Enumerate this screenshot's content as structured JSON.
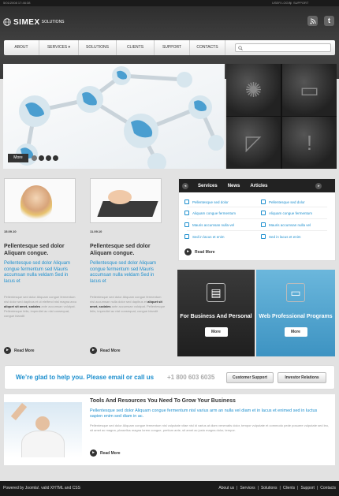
{
  "topbar": {
    "date": "5/01/2008 17:46:38",
    "links": [
      "USER LOGIN",
      "SUPPORT"
    ]
  },
  "brand": {
    "name": "SIMEX",
    "suffix": "SOLUTIONS"
  },
  "nav": {
    "items": [
      "ABOUT",
      "SERVICES",
      "SOLUTIONS",
      "CLIENTS",
      "SUPPORT",
      "CONTACTS"
    ],
    "dropdown_index": 1
  },
  "slider": {
    "caption": "More"
  },
  "cards": [
    {
      "date": "15.09.10",
      "title": "Pellentesque sed dolor Aliquam congue.",
      "blue": "Pellentesque sed dolor Aliquam congue fermentum sed Mauris accumsan nulla veldam Sed in lacus et",
      "body_pre": "Pellentesque sed dolor Aliquam congue fermentum nisl dolor sed dapibus et ut eleifend nisl magna arcu",
      "body_bold": "aliquet sit amet, sodales",
      "body_post": "ante accumsan volutpat. Pellentesque felis, imperdiet ac nisl consequat, congue blandit",
      "readmore": "Read More"
    },
    {
      "date": "11.09.10",
      "title": "Pellentesque sed dolor Aliquam congue.",
      "blue": "Pellentesque sed dolor Aliquam congue fermentum sed Mauris accumsan nulla veldam Sed in lacus et",
      "body_pre": "Pellentesque sed dolor Aliquam congue fermentum nisl accumsan nulla dolor sed dapibus et",
      "body_bold": "aliquet sit amet, sodales",
      "body_post": "ante accumsan volutpat. Pellentesque felis, imperdiet ac nisl consequat, congue blandit",
      "readmore": "Read More"
    }
  ],
  "tabs": {
    "labels": [
      "Services",
      "News",
      "Articles"
    ],
    "links_left": [
      "Pellentesque sed dolor",
      "Aliquam congue fermentum",
      "Mauris accumsan nulla vel",
      "Sed in lacus et enim"
    ],
    "links_right": [
      "Pellentesque sed dolor",
      "Aliquam congue fermentum",
      "Mauris accumsan nulla vel",
      "Sed in lacus et enim"
    ],
    "readmore": "Read More"
  },
  "promos": [
    {
      "title": "For Business And Personal",
      "button": "More"
    },
    {
      "title": "Web Professional Programs",
      "button": "More"
    }
  ],
  "cta": {
    "text": "We’re glad to help you. Please email or call us",
    "phone": "+1 800 603 6035",
    "buttons": [
      "Customer Support",
      "Investor Relations"
    ]
  },
  "tools": {
    "title": "Tools And Resources You Need To Grow Your Business",
    "blue": "Pellentesque sed dolor Aliquam congue fermentum nisl varius arm an nulla vel diam et in lacus et enimed sed in luctus sapien enim sed diam in ac.",
    "body": "Pellentesque sed dolor Aliquam congue fermentum nisl vulputate vitae nisl id varius at diam venenatis dolor, tempor vulputate et commodo pede posuere vulputate sed leo, sit amet ac magna, phasellus magna lorem congue, pretium ante, sit amet ac justo magna dolor, tempor.",
    "readmore": "Read More"
  },
  "footer": {
    "left": "Powered by Joomla!. valid XHTML and CSS",
    "links": [
      "About us",
      "Services",
      "Solutions",
      "Clients",
      "Support",
      "Contacts"
    ]
  },
  "colors": {
    "accent": "#1d8fce",
    "dark": "#222222",
    "promo_blue": "#4fa3cc"
  }
}
